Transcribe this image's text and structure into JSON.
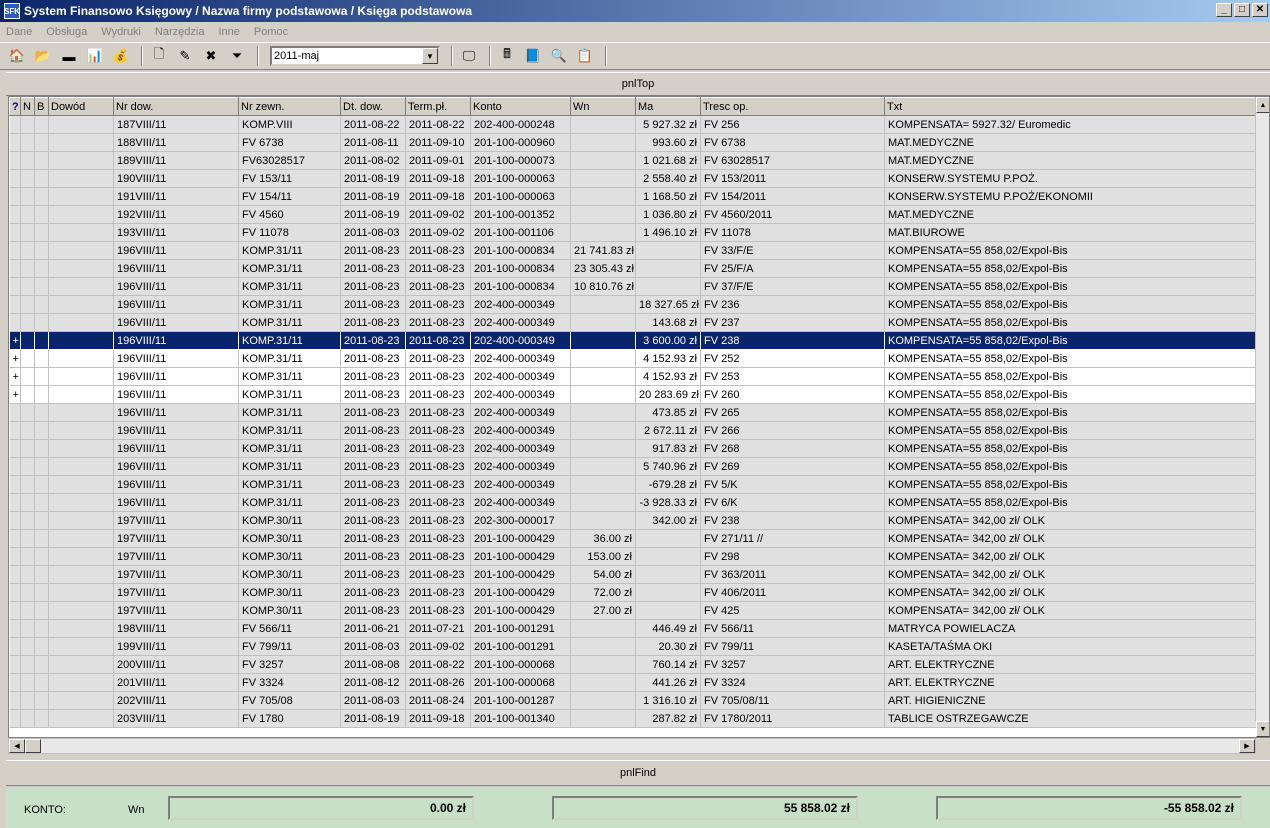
{
  "window": {
    "title": "System Finansowo Księgowy / Nazwa firmy podstawowa / Księga podstawowa",
    "icon_text": "SFK"
  },
  "menu": [
    "Dane",
    "Obsługa",
    "Wydruki",
    "Narzędzia",
    "Inne",
    "Pomoc"
  ],
  "toolbar": {
    "period": "2011-maj"
  },
  "panels": {
    "top": "pnlTop",
    "find": "pnlFind"
  },
  "columns": [
    "?",
    "N",
    "B",
    "Dowód",
    "Nr dow.",
    "Nr zewn.",
    "Dt. dow.",
    "Term.pł.",
    "Konto",
    "Wn",
    "Ma",
    "Tresc op.",
    "Txt"
  ],
  "rows": [
    {
      "m": "",
      "nr": "187VIII/11",
      "zewn": "KOMP.VIII",
      "dt": "2011-08-22",
      "term": "2011-08-22",
      "konto": "202-400-000248",
      "wn": "",
      "ma": "5 927.32 zł",
      "tresc": "FV 256",
      "txt": "KOMPENSATA= 5927.32/ Euromedic"
    },
    {
      "m": "",
      "nr": "188VIII/11",
      "zewn": "FV 6738",
      "dt": "2011-08-11",
      "term": "2011-09-10",
      "konto": "201-100-000960",
      "wn": "",
      "ma": "993.60 zł",
      "tresc": "FV 6738",
      "txt": "MAT.MEDYCZNE"
    },
    {
      "m": "",
      "nr": "189VIII/11",
      "zewn": "FV63028517",
      "dt": "2011-08-02",
      "term": "2011-09-01",
      "konto": "201-100-000073",
      "wn": "",
      "ma": "1 021.68 zł",
      "tresc": "FV 63028517",
      "txt": "MAT.MEDYCZNE"
    },
    {
      "m": "",
      "nr": "190VIII/11",
      "zewn": "FV 153/11",
      "dt": "2011-08-19",
      "term": "2011-09-18",
      "konto": "201-100-000063",
      "wn": "",
      "ma": "2 558.40 zł",
      "tresc": "FV 153/2011",
      "txt": "KONSERW.SYSTEMU P.POŻ."
    },
    {
      "m": "",
      "nr": "191VIII/11",
      "zewn": "FV 154/11",
      "dt": "2011-08-19",
      "term": "2011-09-18",
      "konto": "201-100-000063",
      "wn": "",
      "ma": "1 168.50 zł",
      "tresc": "FV 154/2011",
      "txt": "KONSERW.SYSTEMU P.POŻ/EKONOMII"
    },
    {
      "m": "",
      "nr": "192VIII/11",
      "zewn": "FV 4560",
      "dt": "2011-08-19",
      "term": "2011-09-02",
      "konto": "201-100-001352",
      "wn": "",
      "ma": "1 036.80 zł",
      "tresc": "FV 4560/2011",
      "txt": "MAT.MEDYCZNE"
    },
    {
      "m": "",
      "nr": "193VIII/11",
      "zewn": "FV 11078",
      "dt": "2011-08-03",
      "term": "2011-09-02",
      "konto": "201-100-001106",
      "wn": "",
      "ma": "1 496.10 zł",
      "tresc": "FV 11078",
      "txt": "MAT.BIUROWE"
    },
    {
      "m": "",
      "nr": "196VIII/11",
      "zewn": "KOMP.31/11",
      "dt": "2011-08-23",
      "term": "2011-08-23",
      "konto": "201-100-000834",
      "wn": "21 741.83 zł",
      "ma": "",
      "tresc": "FV 33/F/E",
      "txt": "KOMPENSATA=55 858,02/Expol-Bis"
    },
    {
      "m": "",
      "nr": "196VIII/11",
      "zewn": "KOMP.31/11",
      "dt": "2011-08-23",
      "term": "2011-08-23",
      "konto": "201-100-000834",
      "wn": "23 305.43 zł",
      "ma": "",
      "tresc": "FV 25/F/A",
      "txt": "KOMPENSATA=55 858,02/Expol-Bis"
    },
    {
      "m": "",
      "nr": "196VIII/11",
      "zewn": "KOMP.31/11",
      "dt": "2011-08-23",
      "term": "2011-08-23",
      "konto": "201-100-000834",
      "wn": "10 810.76 zł",
      "ma": "",
      "tresc": "FV 37/F/E",
      "txt": "KOMPENSATA=55 858,02/Expol-Bis"
    },
    {
      "m": "",
      "nr": "196VIII/11",
      "zewn": "KOMP.31/11",
      "dt": "2011-08-23",
      "term": "2011-08-23",
      "konto": "202-400-000349",
      "wn": "",
      "ma": "18 327.65 zł",
      "tresc": "FV 236",
      "txt": "KOMPENSATA=55 858,02/Expol-Bis"
    },
    {
      "m": "",
      "nr": "196VIII/11",
      "zewn": "KOMP.31/11",
      "dt": "2011-08-23",
      "term": "2011-08-23",
      "konto": "202-400-000349",
      "wn": "",
      "ma": "143.68 zł",
      "tresc": "FV 237",
      "txt": "KOMPENSATA=55 858,02/Expol-Bis"
    },
    {
      "m": "+",
      "nr": "196VIII/11",
      "zewn": "KOMP.31/11",
      "dt": "2011-08-23",
      "term": "2011-08-23",
      "konto": "202-400-000349",
      "wn": "",
      "ma": "3 600.00 zł",
      "tresc": "FV 238",
      "txt": "KOMPENSATA=55 858,02/Expol-Bis",
      "sel": true
    },
    {
      "m": "+",
      "nr": "196VIII/11",
      "zewn": "KOMP.31/11",
      "dt": "2011-08-23",
      "term": "2011-08-23",
      "konto": "202-400-000349",
      "wn": "",
      "ma": "4 152.93 zł",
      "tresc": "FV 252",
      "txt": "KOMPENSATA=55 858,02/Expol-Bis",
      "white": true
    },
    {
      "m": "+",
      "nr": "196VIII/11",
      "zewn": "KOMP.31/11",
      "dt": "2011-08-23",
      "term": "2011-08-23",
      "konto": "202-400-000349",
      "wn": "",
      "ma": "4 152.93 zł",
      "tresc": "FV 253",
      "txt": "KOMPENSATA=55 858,02/Expol-Bis",
      "white": true
    },
    {
      "m": "+",
      "nr": "196VIII/11",
      "zewn": "KOMP.31/11",
      "dt": "2011-08-23",
      "term": "2011-08-23",
      "konto": "202-400-000349",
      "wn": "",
      "ma": "20 283.69 zł",
      "tresc": "FV 260",
      "txt": "KOMPENSATA=55 858,02/Expol-Bis",
      "white": true
    },
    {
      "m": "",
      "nr": "196VIII/11",
      "zewn": "KOMP.31/11",
      "dt": "2011-08-23",
      "term": "2011-08-23",
      "konto": "202-400-000349",
      "wn": "",
      "ma": "473.85 zł",
      "tresc": "FV 265",
      "txt": "KOMPENSATA=55 858,02/Expol-Bis"
    },
    {
      "m": "",
      "nr": "196VIII/11",
      "zewn": "KOMP.31/11",
      "dt": "2011-08-23",
      "term": "2011-08-23",
      "konto": "202-400-000349",
      "wn": "",
      "ma": "2 672.11 zł",
      "tresc": "FV 266",
      "txt": "KOMPENSATA=55 858,02/Expol-Bis"
    },
    {
      "m": "",
      "nr": "196VIII/11",
      "zewn": "KOMP.31/11",
      "dt": "2011-08-23",
      "term": "2011-08-23",
      "konto": "202-400-000349",
      "wn": "",
      "ma": "917.83 zł",
      "tresc": "FV 268",
      "txt": "KOMPENSATA=55 858,02/Expol-Bis"
    },
    {
      "m": "",
      "nr": "196VIII/11",
      "zewn": "KOMP.31/11",
      "dt": "2011-08-23",
      "term": "2011-08-23",
      "konto": "202-400-000349",
      "wn": "",
      "ma": "5 740.96 zł",
      "tresc": "FV 269",
      "txt": "KOMPENSATA=55 858,02/Expol-Bis"
    },
    {
      "m": "",
      "nr": "196VIII/11",
      "zewn": "KOMP.31/11",
      "dt": "2011-08-23",
      "term": "2011-08-23",
      "konto": "202-400-000349",
      "wn": "",
      "ma": "-679.28 zł",
      "tresc": "FV 5/K",
      "txt": "KOMPENSATA=55 858,02/Expol-Bis"
    },
    {
      "m": "",
      "nr": "196VIII/11",
      "zewn": "KOMP.31/11",
      "dt": "2011-08-23",
      "term": "2011-08-23",
      "konto": "202-400-000349",
      "wn": "",
      "ma": "-3 928.33 zł",
      "tresc": "FV 6/K",
      "txt": "KOMPENSATA=55 858,02/Expol-Bis"
    },
    {
      "m": "",
      "nr": "197VIII/11",
      "zewn": "KOMP.30/11",
      "dt": "2011-08-23",
      "term": "2011-08-23",
      "konto": "202-300-000017",
      "wn": "",
      "ma": "342.00 zł",
      "tresc": "FV 238",
      "txt": "KOMPENSATA= 342,00 zł/  OLK"
    },
    {
      "m": "",
      "nr": "197VIII/11",
      "zewn": "KOMP.30/11",
      "dt": "2011-08-23",
      "term": "2011-08-23",
      "konto": "201-100-000429",
      "wn": "36.00 zł",
      "ma": "",
      "tresc": "FV 271/11 //",
      "txt": "KOMPENSATA= 342,00 zł/  OLK"
    },
    {
      "m": "",
      "nr": "197VIII/11",
      "zewn": "KOMP.30/11",
      "dt": "2011-08-23",
      "term": "2011-08-23",
      "konto": "201-100-000429",
      "wn": "153.00 zł",
      "ma": "",
      "tresc": "FV 298",
      "txt": "KOMPENSATA= 342,00 zł/  OLK"
    },
    {
      "m": "",
      "nr": "197VIII/11",
      "zewn": "KOMP.30/11",
      "dt": "2011-08-23",
      "term": "2011-08-23",
      "konto": "201-100-000429",
      "wn": "54.00 zł",
      "ma": "",
      "tresc": "FV 363/2011",
      "txt": "KOMPENSATA= 342,00 zł/  OLK"
    },
    {
      "m": "",
      "nr": "197VIII/11",
      "zewn": "KOMP.30/11",
      "dt": "2011-08-23",
      "term": "2011-08-23",
      "konto": "201-100-000429",
      "wn": "72.00 zł",
      "ma": "",
      "tresc": "FV 406/2011",
      "txt": "KOMPENSATA= 342,00 zł/  OLK"
    },
    {
      "m": "",
      "nr": "197VIII/11",
      "zewn": "KOMP.30/11",
      "dt": "2011-08-23",
      "term": "2011-08-23",
      "konto": "201-100-000429",
      "wn": "27.00 zł",
      "ma": "",
      "tresc": "FV 425",
      "txt": "KOMPENSATA= 342,00 zł/  OLK"
    },
    {
      "m": "",
      "nr": "198VIII/11",
      "zewn": "FV 566/11",
      "dt": "2011-06-21",
      "term": "2011-07-21",
      "konto": "201-100-001291",
      "wn": "",
      "ma": "446.49 zł",
      "tresc": "FV 566/11",
      "txt": "MATRYCA POWIELACZA"
    },
    {
      "m": "",
      "nr": "199VIII/11",
      "zewn": "FV 799/11",
      "dt": "2011-08-03",
      "term": "2011-09-02",
      "konto": "201-100-001291",
      "wn": "",
      "ma": "20.30 zł",
      "tresc": "FV 799/11",
      "txt": "KASETA/TAŚMA OKI"
    },
    {
      "m": "",
      "nr": "200VIII/11",
      "zewn": "FV 3257",
      "dt": "2011-08-08",
      "term": "2011-08-22",
      "konto": "201-100-000068",
      "wn": "",
      "ma": "760.14 zł",
      "tresc": "FV 3257",
      "txt": "ART. ELEKTRYCZNE"
    },
    {
      "m": "",
      "nr": "201VIII/11",
      "zewn": "FV 3324",
      "dt": "2011-08-12",
      "term": "2011-08-26",
      "konto": "201-100-000068",
      "wn": "",
      "ma": "441.26 zł",
      "tresc": "FV 3324",
      "txt": "ART. ELEKTRYCZNE"
    },
    {
      "m": "",
      "nr": "202VIII/11",
      "zewn": "FV 705/08",
      "dt": "2011-08-03",
      "term": "2011-08-24",
      "konto": "201-100-001287",
      "wn": "",
      "ma": "1 316.10 zł",
      "tresc": "FV 705/08/11",
      "txt": "ART. HIGIENICZNE"
    },
    {
      "m": "",
      "nr": "203VIII/11",
      "zewn": "FV 1780",
      "dt": "2011-08-19",
      "term": "2011-09-18",
      "konto": "201-100-001340",
      "wn": "",
      "ma": "287.82 zł",
      "tresc": "FV 1780/2011",
      "txt": "TABLICE OSTRZEGAWCZE"
    }
  ],
  "footer": {
    "konto_label": "KONTO:",
    "wn_label": "Wn",
    "sum1": "0.00 zł",
    "sum2": "55 858.02 zł",
    "sum3": "-55 858.02 zł"
  }
}
